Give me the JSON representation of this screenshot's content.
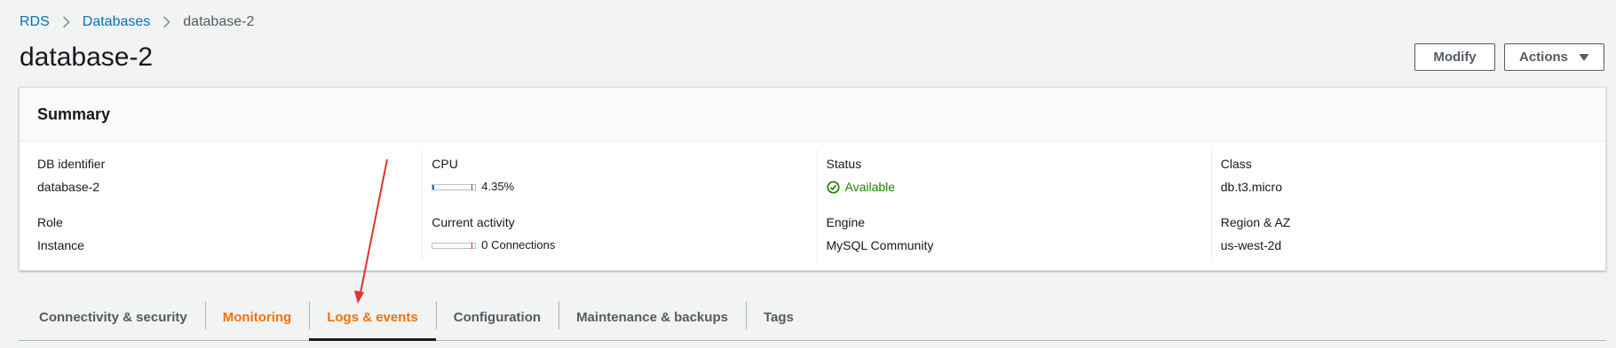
{
  "breadcrumb": {
    "items": [
      "RDS",
      "Databases",
      "database-2"
    ]
  },
  "page": {
    "title": "database-2"
  },
  "header_buttons": {
    "modify": "Modify",
    "actions": "Actions"
  },
  "summary": {
    "title": "Summary",
    "db_identifier": {
      "label": "DB identifier",
      "value": "database-2"
    },
    "role": {
      "label": "Role",
      "value": "Instance"
    },
    "cpu": {
      "label": "CPU",
      "value": "4.35%",
      "fraction": 0.0435
    },
    "current_activity": {
      "label": "Current activity",
      "value": "0 Connections",
      "fraction": 0
    },
    "status": {
      "label": "Status",
      "value": "Available"
    },
    "engine": {
      "label": "Engine",
      "value": "MySQL Community"
    },
    "class": {
      "label": "Class",
      "value": "db.t3.micro"
    },
    "region_az": {
      "label": "Region & AZ",
      "value": "us-west-2d"
    }
  },
  "tabs": [
    {
      "label": "Connectivity & security",
      "state": "default"
    },
    {
      "label": "Monitoring",
      "state": "highlighted"
    },
    {
      "label": "Logs & events",
      "state": "active"
    },
    {
      "label": "Configuration",
      "state": "default"
    },
    {
      "label": "Maintenance & backups",
      "state": "default"
    },
    {
      "label": "Tags",
      "state": "default"
    }
  ],
  "colors": {
    "link": "#0073bb",
    "accent_orange": "#ec7211",
    "status_green": "#1d8102",
    "annotation_arrow": "#e0342b"
  },
  "icons": {
    "breadcrumb_separator": "chevron-right-icon",
    "actions_caret": "caret-down-icon",
    "status": "check-circle-icon"
  }
}
